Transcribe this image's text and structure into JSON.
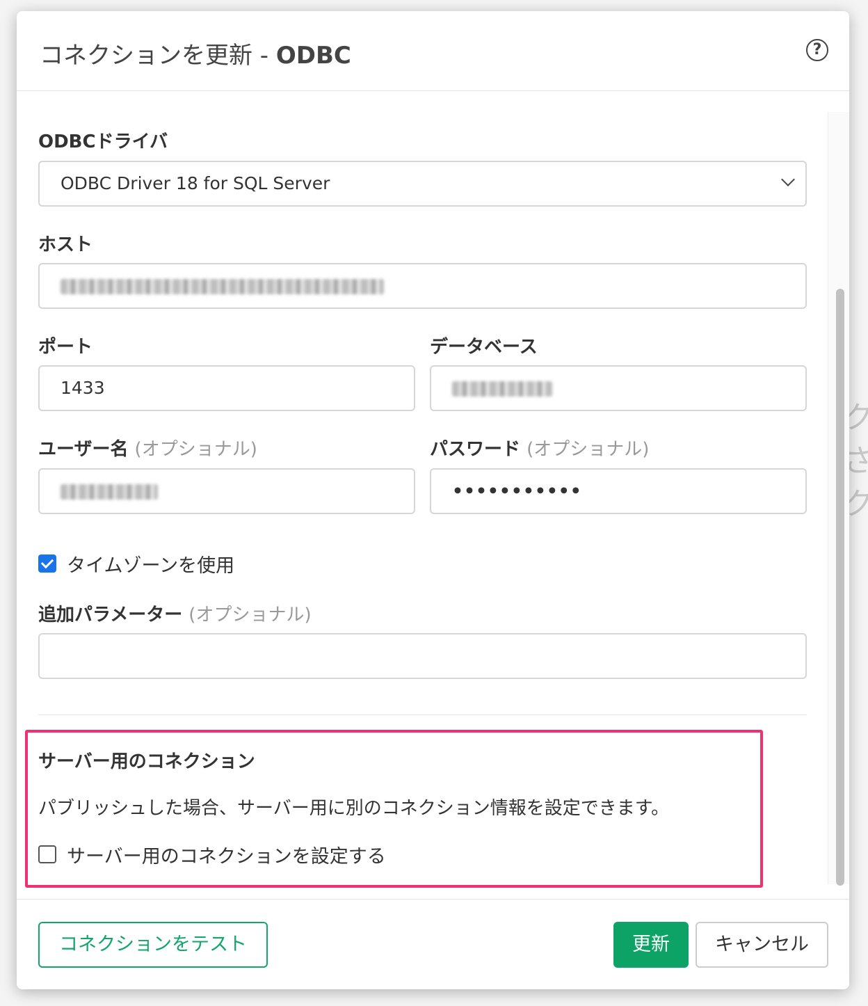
{
  "background_text": "ク\nさ\nク",
  "dialog": {
    "title": "コネクションを更新",
    "title_separator": " - ",
    "subtitle": "ODBC",
    "help_icon": "question-circle-icon"
  },
  "form": {
    "driver_label": "ODBCドライバ",
    "driver_value": "ODBC Driver 18 for SQL Server",
    "host_label": "ホスト",
    "host_value": "",
    "port_label": "ポート",
    "port_value": "1433",
    "database_label": "データベース",
    "database_value": "",
    "username_label": "ユーザー名",
    "username_optional": "(オプショナル)",
    "username_value": "",
    "password_label": "パスワード",
    "password_optional": "(オプショナル)",
    "password_value": "•••••••••••",
    "timezone_label": "タイムゾーンを使用",
    "timezone_checked": true,
    "extra_params_label": "追加パラメーター",
    "extra_params_optional": "(オプショナル)",
    "extra_params_value": ""
  },
  "server_section": {
    "title": "サーバー用のコネクション",
    "description": "パブリッシュした場合、サーバー用に別のコネクション情報を設定できます。",
    "checkbox_label": "サーバー用のコネクションを設定する",
    "checkbox_checked": false,
    "highlight_color": "#f0306f"
  },
  "footer": {
    "test_button": "コネクションをテスト",
    "update_button": "更新",
    "cancel_button": "キャンセル"
  },
  "colors": {
    "primary_green": "#0ea366",
    "checkbox_blue": "#1a73e8"
  }
}
